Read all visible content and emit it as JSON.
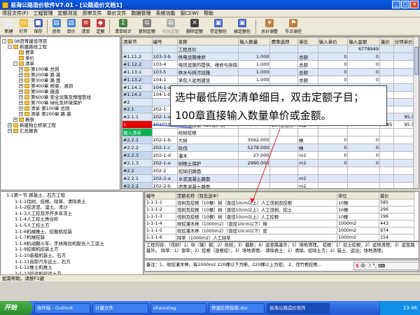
{
  "window": {
    "title": "易海公路造价软件V7.01 - [公路造价文档1]"
  },
  "menu": [
    "项目文件(F)",
    "工程管理",
    "定额浏览",
    "资审文件",
    "单价文件",
    "数据管理",
    "系统功能",
    "窗口(W)",
    "帮助"
  ],
  "toolbar": [
    {
      "label": "新建",
      "color": "#e8e8e8",
      "glyph": "□"
    },
    {
      "label": "打开",
      "color": "#e8c040",
      "glyph": "▭"
    },
    {
      "label": "保存",
      "color": "#4060c0",
      "glyph": "■"
    },
    {
      "label": "资审",
      "color": "#4080d0",
      "glyph": "▤"
    },
    {
      "label": "单价",
      "color": "#4080d0",
      "glyph": "▤"
    },
    {
      "label": "清单",
      "color": "#c04040",
      "glyph": "≡"
    },
    {
      "label": "定额",
      "color": "#c04040",
      "glyph": "◆"
    },
    {
      "label": "清单统计",
      "color": "#408040",
      "glyph": "Σ",
      "wide": true
    },
    {
      "label": "复制定额",
      "color": "#808080",
      "glyph": "⧉",
      "wide": true
    },
    {
      "label": "粘贴定额",
      "color": "#b0b0b0",
      "glyph": "⧉",
      "wide": true,
      "disabled": true
    },
    {
      "label": "删除定额",
      "color": "#404040",
      "glyph": "✕",
      "wide": true
    },
    {
      "label": "存定额包",
      "color": "#4060c0",
      "glyph": "▣",
      "wide": true
    },
    {
      "label": "插定额包",
      "color": "#4060c0",
      "glyph": "▣",
      "wide": true
    },
    {
      "label": "总价调整",
      "color": "#c08040",
      "glyph": "¥",
      "wide": true
    },
    {
      "label": "节点调控",
      "color": "#c08040",
      "glyph": "⚑",
      "wide": true
    }
  ],
  "tree": [
    {
      "text": "08沥青建设项目",
      "lvl": 0,
      "box": "-"
    },
    {
      "text": "新建路线工程",
      "lvl": 1,
      "box": "-"
    },
    {
      "text": "费率",
      "lvl": 2,
      "box": ""
    },
    {
      "text": "单价",
      "lvl": 2,
      "box": ""
    },
    {
      "text": "清单",
      "lvl": 2,
      "box": "-"
    },
    {
      "text": "第100章 总则",
      "lvl": 3,
      "box": "+"
    },
    {
      "text": "第200章 路 基",
      "lvl": 3,
      "box": "+"
    },
    {
      "text": "第300章 路 面",
      "lvl": 3,
      "box": "+"
    },
    {
      "text": "第400章 桥梁、涵洞",
      "lvl": 3,
      "box": "+"
    },
    {
      "text": "第500章 隧道",
      "lvl": 3,
      "box": "+"
    },
    {
      "text": "第600章 安全设施及预埋管线",
      "lvl": 3,
      "box": "+"
    },
    {
      "text": "第700章 绿化及环境保护",
      "lvl": 3,
      "box": "+"
    },
    {
      "text": "清单 第100章 总则",
      "lvl": 3,
      "box": "+"
    },
    {
      "text": "清单 第200章 路 基",
      "lvl": 3,
      "box": "+"
    },
    {
      "text": "报表",
      "lvl": 2,
      "box": "+"
    },
    {
      "text": "新建独立桥梁工程",
      "lvl": 1,
      "box": "+"
    },
    {
      "text": "汇总报表",
      "lvl": 1,
      "box": "+"
    }
  ],
  "grid": {
    "headers": [
      "清单节",
      "编号",
      "名称",
      "输入数量",
      "费率选项",
      "单位",
      "输入单价",
      "输入金额",
      "基价",
      "分项单价"
    ],
    "rows": [
      {
        "c": [
          "",
          "",
          "工程总价",
          "",
          "",
          "",
          "",
          "6778949",
          "",
          ""
        ],
        "cls": "blue"
      },
      {
        "c": [
          "#1.11.2",
          "103-3-b",
          "供电设施维修",
          "1.000",
          "",
          "总额",
          "0",
          "0",
          "",
          ""
        ],
        "cls": "blue"
      },
      {
        "c": [
          "#1.12.2",
          "103-4",
          "电讯设施的提供、维修与拆除",
          "1.000",
          "",
          "总额",
          "0",
          "0",
          "",
          ""
        ],
        "cls": ""
      },
      {
        "c": [
          "#1.13.1",
          "103-5",
          "供水与排污设施",
          "1.000",
          "",
          "总额",
          "0",
          "0",
          "",
          ""
        ],
        "cls": "blue"
      },
      {
        "c": [
          "#1.13.2",
          "104-1",
          "承包人驻地建设",
          "1.000",
          "",
          "总额",
          "0",
          "0",
          "",
          ""
        ],
        "cls": ""
      },
      {
        "c": [
          "#1.14.1",
          "104-1-a",
          "",
          "",
          "",
          "",
          "",
          "",
          "",
          ""
        ],
        "cls": "blue"
      },
      {
        "c": [
          "#1.14.2",
          "104-1-b",
          "",
          "",
          "",
          "",
          "",
          "",
          "",
          ""
        ],
        "cls": ""
      },
      {
        "c": [
          "#2",
          "",
          "",
          "",
          "",
          "",
          "",
          "",
          "",
          ""
        ],
        "cls": "blue"
      },
      {
        "c": [
          "#2.1",
          "202-1",
          "",
          "",
          "",
          "",
          "",
          "",
          "",
          ""
        ],
        "cls": ""
      },
      {
        "c": [
          "#2.1.1",
          "202-1-a",
          "",
          "",
          "",
          "",
          "",
          "",
          "",
          "95.59"
        ],
        "cls": "blue"
      },
      {
        "c": [
          "1",
          "10101001",
          "伐树及挖根（10棵）树",
          "67520.000",
          "1.人工土方",
          "1棵",
          "95.59",
          "6454009.78",
          "585",
          "95.59"
        ],
        "cls": "red"
      },
      {
        "c": [
          "输入清单",
          "",
          "砍树挖根",
          "",
          "",
          "",
          "",
          "",
          "",
          ""
        ],
        "cls": "green"
      },
      {
        "c": [
          "#2.2.1",
          "202-1-b",
          "大树",
          "3562.000",
          "",
          "株",
          "0",
          "0",
          "",
          ""
        ],
        "cls": ""
      },
      {
        "c": [
          "#2.2.2",
          "202-1-c",
          "砍伐",
          "5278.000",
          "",
          "株",
          "0",
          "0",
          "",
          ""
        ],
        "cls": "blue"
      },
      {
        "c": [
          "#2.2.3",
          "202-1-d",
          "灌木",
          "27.000",
          "",
          "m2",
          "0",
          "0",
          "",
          ""
        ],
        "cls": ""
      },
      {
        "c": [
          "#2.1.3",
          "202-1-e",
          "树根土保护",
          "2990.000",
          "",
          "m2",
          "0",
          "0",
          "",
          ""
        ],
        "cls": "blue"
      },
      {
        "c": [
          "#2.2",
          "202-2",
          "挖除旧路面",
          "",
          "",
          "",
          "",
          "",
          "",
          ""
        ],
        "cls": ""
      },
      {
        "c": [
          "#2.2.1",
          "202-2-a",
          "水泥混凝土路面",
          "",
          "",
          "m2",
          "",
          "",
          "",
          ""
        ],
        "cls": "blue"
      },
      {
        "c": [
          "#2.2.2",
          "202-2-b",
          "沥青混凝土路面",
          "",
          "",
          "m2",
          "",
          "",
          "",
          ""
        ],
        "cls": ""
      },
      {
        "c": [
          "#2.2.3",
          "202-2-c",
          "碎（砾）石路面",
          "",
          "",
          "m2",
          "",
          "",
          "",
          ""
        ],
        "cls": "blue"
      }
    ]
  },
  "tooltip": "选中最低层次清单细目，双击定额子目；100章直接输入数量单价或金额。",
  "list": [
    "1-1第一节 路基土、石方工程",
    "1-1-1伐树、挖根、除草、清除表土",
    "1-1-2挖淤泥、湿土、流沙",
    "1-1-3人工挖及开炸多年冻土",
    "1-1-4人工挖土质台阶",
    "1-1-5人工挖土方",
    "1-1-6机械推土、挖掘机挖装",
    "1-1-7机械挖装",
    "1-1-8机动翻斗车、手扶拖拉机配合人工运土",
    "1-1-9挖掘机挖装土方",
    "1-1-10装载机装土、石方",
    "1-1-11自卸汽车运土、石方",
    "1-1-12推土机推土",
    "1-1-13铲运机铲运土方"
  ],
  "quota": {
    "headers": [
      "编号",
      "定额名称（双击选中）",
      "单位",
      "基价"
    ],
    "rows": [
      [
        "1-1-1-1",
        "伐树及挖根（10棵）树（直径10cm以上）人工伐树及挖根",
        "10棵",
        "585"
      ],
      [
        "1-1-1-2",
        "伐树及挖根（10棵）树（直径10cm以上）人工伐树、挖土",
        "10棵",
        "296"
      ],
      [
        "1-1-1-3",
        "伐树及挖根（10棵）树（直径10cm以上）人工挖根",
        "10棵",
        "196"
      ],
      [
        "1-1-1-4",
        "砍挖灌木林（1000m2）（直径10cm以下）稀",
        "1000m2",
        "443"
      ],
      [
        "1-1-1-5",
        "砍挖灌木林（1000m2）（直径10cm以下）密",
        "1000m2",
        "974"
      ],
      [
        "1-1-1-6",
        "除草（1000m2）人工除草",
        "1000m2",
        "154"
      ],
      [
        "1-1-1-7",
        "除草（1000m2）人工挖草皮",
        "1000m2",
        "1014"
      ]
    ]
  },
  "desc": "工程内容：（伐树）1）砍（锯）倒；2）砍枝；3）截断；4）运至路基外；5）场地清理。 挖根：1）挖土挖根；2）运地清理；3）运至路基外。 除草：1）割草；2）挖根（连根挖）；3）场地清理。 清除表土：1）清除、挖除土方；2）装土、运出；场地清理。",
  "note": "备注：1、砍挖灌木林，每1000m2 220棵以下为稀，220棵以上为密。    2、伐竹根挖根...",
  "statusbar": "如需帮助，请按F1键",
  "taskbar": {
    "start": "开始",
    "tasks": [
      "收件箱 - Outlook",
      "计量文件",
      "sharextag",
      "快速应用指南.doc",
      "易海公路造价软件"
    ],
    "clock": "13:46"
  }
}
